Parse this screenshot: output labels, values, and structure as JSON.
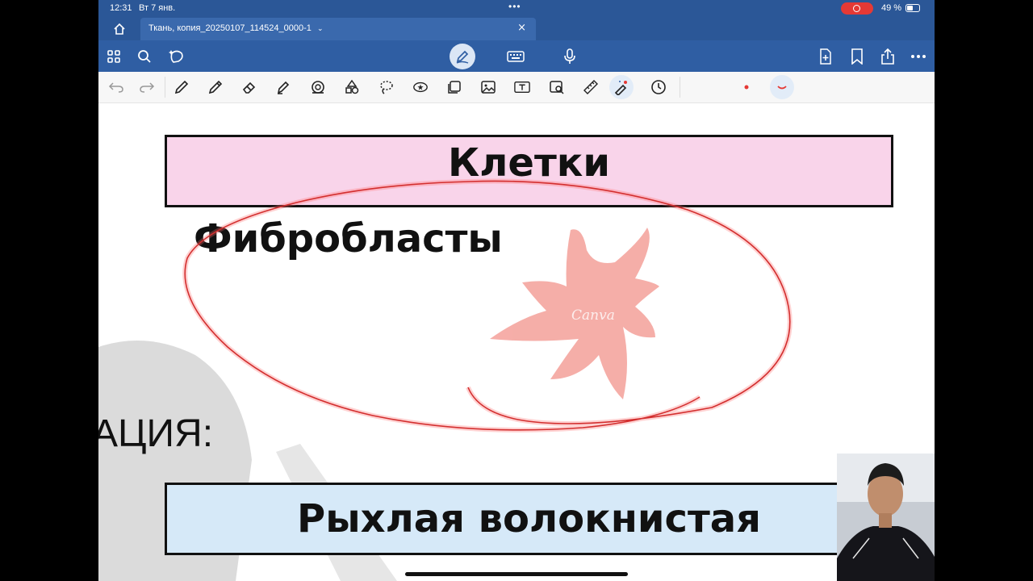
{
  "status": {
    "time": "12:31",
    "date": "Вт 7 янв.",
    "battery": "49 %"
  },
  "tab": {
    "title": "Ткань, копия_20250107_114524_0000-1",
    "dropdown_icon": "chevron-down-icon",
    "close": "×"
  },
  "slide": {
    "title": "Клетки",
    "cell_label": "Фибробласты",
    "partial_heading": "АЦИЯ:",
    "bottom_title": "Рыхлая волокнистая",
    "watermark": "Canva"
  },
  "colors": {
    "title_bg": "#f9d4ea",
    "bottom_bg": "#d6e9f8",
    "app_bar": "#2f5ea3",
    "ink_red": "#e53935",
    "cell_fill": "#f4a09a"
  }
}
